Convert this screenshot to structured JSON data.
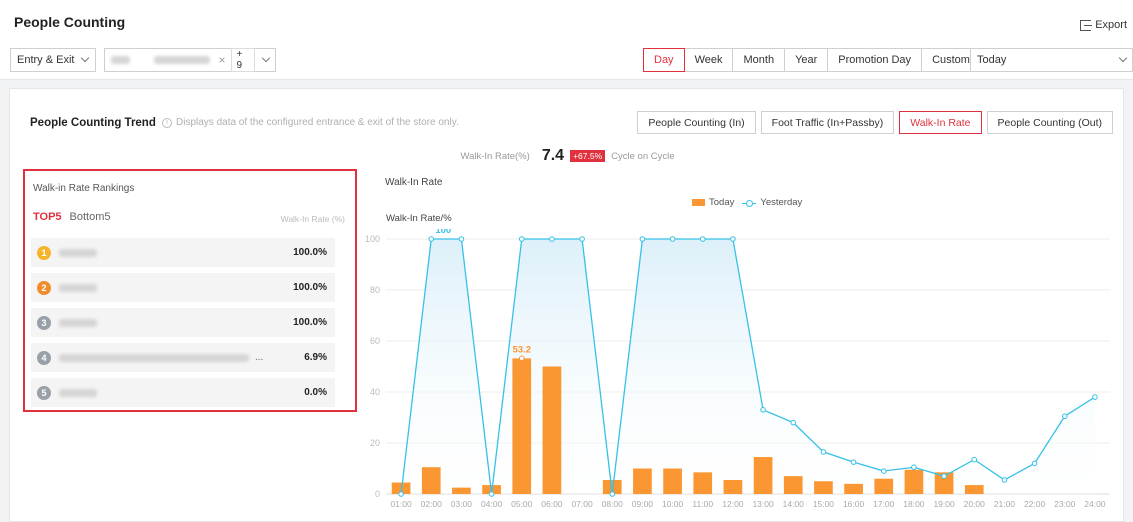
{
  "header": {
    "title": "People Counting",
    "export_label": "Export"
  },
  "filters": {
    "direction": "Entry & Exit",
    "more_count": "+ 9",
    "periods": [
      "Day",
      "Week",
      "Month",
      "Year",
      "Promotion Day",
      "Custom"
    ],
    "active_period": "Day",
    "date_value": "Today"
  },
  "trend": {
    "title": "People Counting Trend",
    "note": "Displays data of the configured entrance & exit of the store only.",
    "metrics": [
      "People Counting (In)",
      "Foot Traffic (In+Passby)",
      "Walk-In Rate",
      "People Counting (Out)"
    ],
    "active_metric": "Walk-In Rate",
    "summary_label": "Walk-In Rate(%)",
    "summary_value": "7.4",
    "summary_change": "+67.5%",
    "summary_suffix": "Cycle on Cycle"
  },
  "rankings": {
    "title": "Walk-in Rate Rankings",
    "tab_top": "TOP5",
    "tab_bottom": "Bottom5",
    "column_header": "Walk-In Rate (%)",
    "medal_colors": [
      "#f6b42c",
      "#f08d2c",
      "#9aa0a8",
      "#9aa0a8",
      "#9aa0a8"
    ],
    "rows": [
      {
        "rank": "1",
        "value": "100.0%"
      },
      {
        "rank": "2",
        "value": "100.0%"
      },
      {
        "rank": "3",
        "value": "100.0%"
      },
      {
        "rank": "4",
        "value": "6.9%",
        "ellipsis": "..."
      },
      {
        "rank": "5",
        "value": "0.0%"
      }
    ]
  },
  "chart": {
    "title": "Walk-In Rate",
    "colors": {
      "today": "#fb9733",
      "yesterday": "#36c1e8"
    }
  },
  "chart_data": {
    "type": "bar",
    "ylabel": "Walk-In Rate/%",
    "ylim": [
      0,
      100
    ],
    "yticks": [
      0,
      20,
      40,
      60,
      80,
      100
    ],
    "legend_position": "top",
    "categories": [
      "01:00",
      "02:00",
      "03:00",
      "04:00",
      "05:00",
      "06:00",
      "07:00",
      "08:00",
      "09:00",
      "10:00",
      "11:00",
      "12:00",
      "13:00",
      "14:00",
      "15:00",
      "16:00",
      "17:00",
      "18:00",
      "19:00",
      "20:00",
      "21:00",
      "22:00",
      "23:00",
      "24:00"
    ],
    "series": [
      {
        "name": "Today",
        "type": "bar",
        "values": [
          4.5,
          10.5,
          2.5,
          3.5,
          53.2,
          50,
          0,
          5.5,
          10,
          10,
          8.5,
          5.5,
          14.5,
          7,
          5,
          4,
          6,
          9.5,
          8.5,
          3.5,
          0,
          0,
          0,
          0
        ]
      },
      {
        "name": "Yesterday",
        "type": "line",
        "values": [
          0,
          100,
          100,
          0,
          100,
          100,
          100,
          0,
          100,
          100,
          100,
          100,
          33,
          28,
          16.5,
          12.5,
          9,
          10.5,
          7,
          13.5,
          5.5,
          12,
          30.5,
          38
        ]
      }
    ],
    "annotations": [
      {
        "series": "Yesterday",
        "x": "02:00",
        "label": "100"
      },
      {
        "series": "Today",
        "x": "05:00",
        "label": "53.2"
      }
    ]
  }
}
